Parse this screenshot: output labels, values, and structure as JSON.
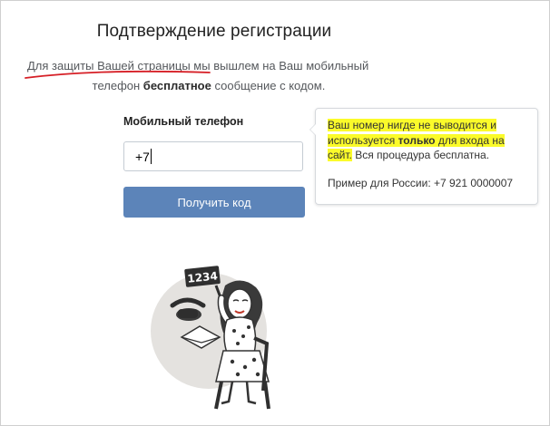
{
  "page": {
    "title": "Подтверждение регистрации",
    "intro": {
      "underlined": "Для защиты Вашей страницы",
      "part1": " мы вышлем на Ваш мобильный",
      "part2": "телефон ",
      "bold": "бесплатное",
      "part3": " сообщение с кодом."
    }
  },
  "form": {
    "phone_label": "Мобильный телефон",
    "phone_value": "+7",
    "submit_label": "Получить код"
  },
  "tooltip": {
    "highlight1": "Ваш номер нигде не выводится и используется ",
    "highlight_bold": "только",
    "highlight2": " для входа на сайт.",
    "rest": " Вся процедура бесплатна.",
    "example": "Пример для России: +7 921 0000007"
  },
  "illustration": {
    "sign_text": "1234"
  },
  "colors": {
    "button": "#5c84b9",
    "highlight": "#fbfb2a",
    "underline": "#d61f26",
    "illustration_bg": "#e4e2df"
  }
}
